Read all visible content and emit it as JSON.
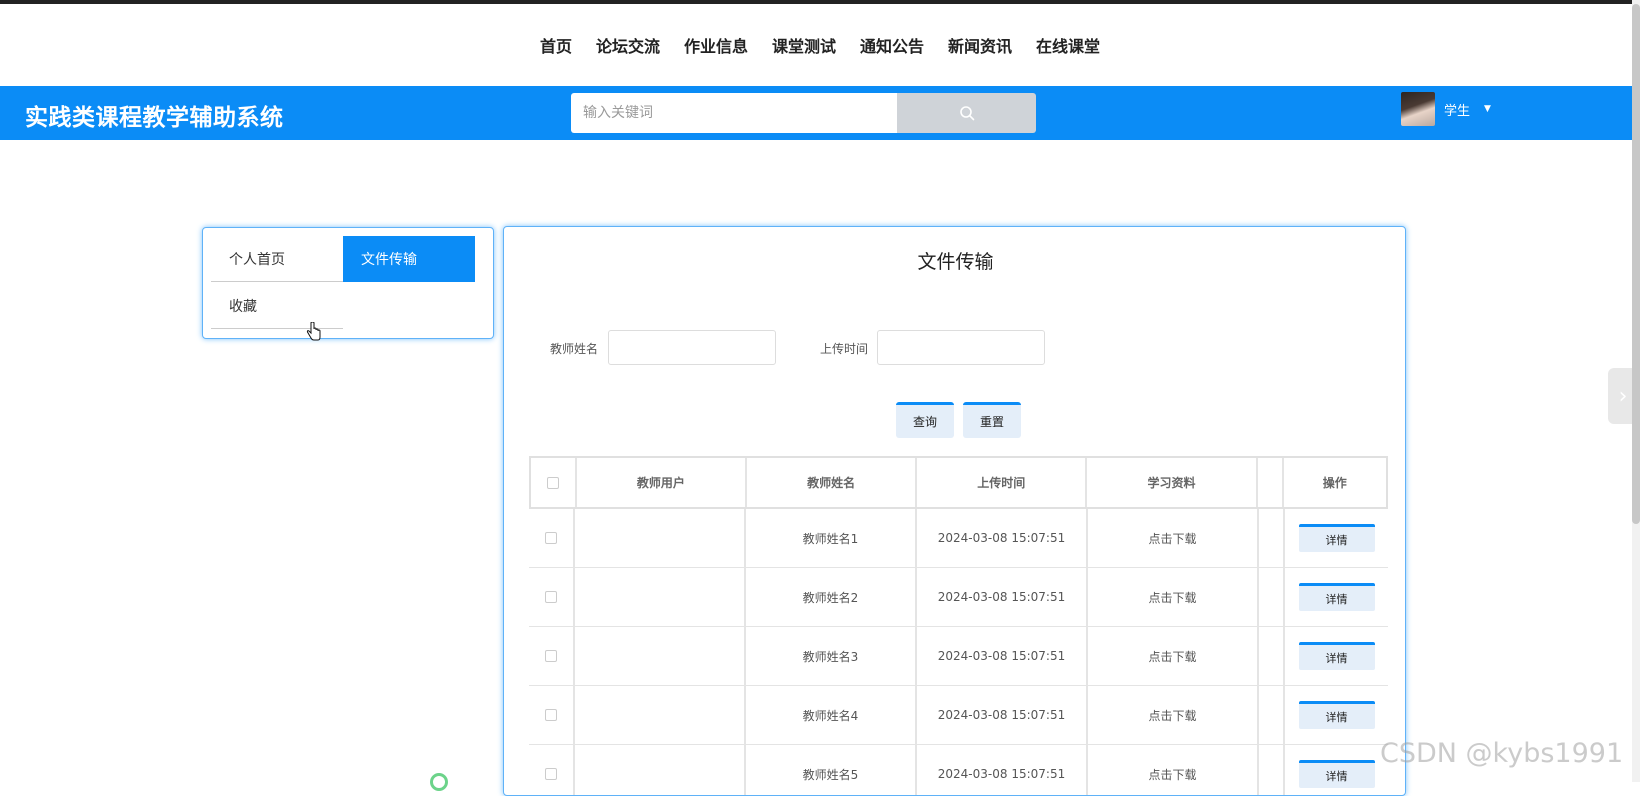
{
  "nav": {
    "items": [
      "首页",
      "论坛交流",
      "作业信息",
      "课堂测试",
      "通知公告",
      "新闻资讯",
      "在线课堂"
    ]
  },
  "header": {
    "site_title": "实践类课程教学辅助系统",
    "search_placeholder": "输入关键词",
    "search_icon": "search-icon",
    "user_name": "学生",
    "accent_color": "#0b8cf6"
  },
  "sidebar": {
    "items": [
      {
        "label": "个人首页",
        "active": false
      },
      {
        "label": "文件传输",
        "active": true
      },
      {
        "label": "收藏",
        "active": false
      }
    ]
  },
  "main": {
    "title": "文件传输",
    "filters": {
      "teacher_name_label": "教师姓名",
      "upload_time_label": "上传时间"
    },
    "buttons": {
      "query": "查询",
      "reset": "重置"
    },
    "table": {
      "headers": [
        "教师用户",
        "教师姓名",
        "上传时间",
        "学习资料",
        "",
        "操作"
      ],
      "rows": [
        {
          "user": "",
          "name": "教师姓名1",
          "time": "2024-03-08 15:07:51",
          "file": "点击下载",
          "action": "详情"
        },
        {
          "user": "",
          "name": "教师姓名2",
          "time": "2024-03-08 15:07:51",
          "file": "点击下载",
          "action": "详情"
        },
        {
          "user": "",
          "name": "教师姓名3",
          "time": "2024-03-08 15:07:51",
          "file": "点击下载",
          "action": "详情"
        },
        {
          "user": "",
          "name": "教师姓名4",
          "time": "2024-03-08 15:07:51",
          "file": "点击下载",
          "action": "详情"
        },
        {
          "user": "",
          "name": "教师姓名5",
          "time": "2024-03-08 15:07:51",
          "file": "点击下载",
          "action": "详情"
        }
      ]
    }
  },
  "watermark": "CSDN @kybs1991"
}
